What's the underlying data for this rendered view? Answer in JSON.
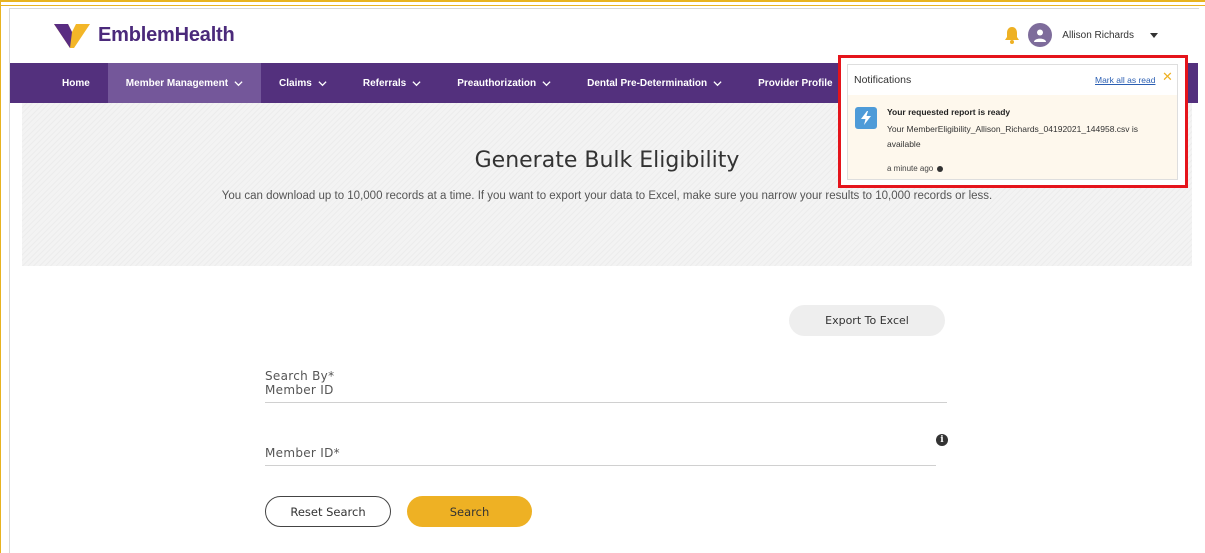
{
  "header": {
    "brand": "EmblemHealth",
    "user_name": "Allison Richards"
  },
  "nav": {
    "items": [
      {
        "label": "Home",
        "has_chevron": false
      },
      {
        "label": "Member Management",
        "has_chevron": true
      },
      {
        "label": "Claims",
        "has_chevron": true
      },
      {
        "label": "Referrals",
        "has_chevron": true
      },
      {
        "label": "Preauthorization",
        "has_chevron": true
      },
      {
        "label": "Dental Pre-Determination",
        "has_chevron": true
      },
      {
        "label": "Provider Profile",
        "has_chevron": false
      }
    ]
  },
  "hero": {
    "title": "Generate Bulk Eligibility",
    "subtitle": "You can download up to 10,000 records at a time. If you want to export your data to Excel, make sure you narrow your results to 10,000 records or less."
  },
  "form": {
    "export_label": "Export To Excel",
    "search_by_label": "Search By*",
    "search_by_value": "Member ID",
    "member_id_label": "Member ID*",
    "info_glyph": "i",
    "reset_label": "Reset Search",
    "search_label": "Search"
  },
  "notifications": {
    "title": "Notifications",
    "mark_all_label": "Mark all as read",
    "close_glyph": "✕",
    "items": [
      {
        "title": "Your requested report is ready",
        "body": "Your MemberEligibility_Allison_Richards_04192021_144958.csv is available",
        "time": "a minute ago"
      }
    ]
  },
  "colors": {
    "brand_purple": "#53307d",
    "nav_active": "#74579a",
    "accent_gold": "#eeb124",
    "highlight_red": "#e5141b",
    "link_blue": "#2b5fb3"
  },
  "icons": {
    "bell": "bell-icon",
    "avatar": "user-avatar-icon",
    "caret": "caret-down-icon",
    "chevron": "chevron-down-icon",
    "info": "info-icon",
    "close": "close-icon",
    "bolt": "lightning-bolt-icon"
  }
}
